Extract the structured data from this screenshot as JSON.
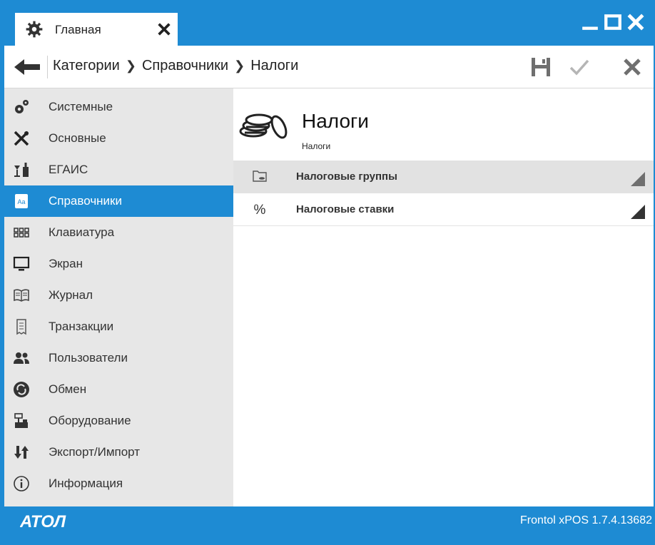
{
  "titlebar": {
    "tab_label": "Главная"
  },
  "breadcrumb": {
    "items": [
      "Категории",
      "Справочники",
      "Налоги"
    ]
  },
  "sidebar": {
    "items": [
      {
        "label": "Системные",
        "icon": "gears-icon"
      },
      {
        "label": "Основные",
        "icon": "tools-icon"
      },
      {
        "label": "ЕГАИС",
        "icon": "bottles-icon"
      },
      {
        "label": "Справочники",
        "icon": "dictionary-icon",
        "active": true
      },
      {
        "label": "Клавиатура",
        "icon": "keyboard-icon"
      },
      {
        "label": "Экран",
        "icon": "monitor-icon"
      },
      {
        "label": "Журнал",
        "icon": "book-icon"
      },
      {
        "label": "Транзакции",
        "icon": "receipt-icon"
      },
      {
        "label": "Пользователи",
        "icon": "users-icon"
      },
      {
        "label": "Обмен",
        "icon": "sync-icon"
      },
      {
        "label": "Оборудование",
        "icon": "cash-register-icon"
      },
      {
        "label": "Экспорт/Импорт",
        "icon": "export-import-icon"
      },
      {
        "label": "Информация",
        "icon": "info-icon"
      }
    ]
  },
  "main": {
    "title": "Налоги",
    "subtitle": "Налоги",
    "rows": [
      {
        "label": "Налоговые группы",
        "icon": "folder-icon",
        "selected": true
      },
      {
        "label": "Налоговые ставки",
        "icon": "percent-icon",
        "selected": false
      }
    ]
  },
  "footer": {
    "brand": "АТОЛ",
    "version": "Frontol xPOS 1.7.4.13682"
  },
  "colors": {
    "accent": "#1e8bd3",
    "sidebar_bg": "#e7e7e7",
    "selected_row": "#e2e2e2"
  }
}
